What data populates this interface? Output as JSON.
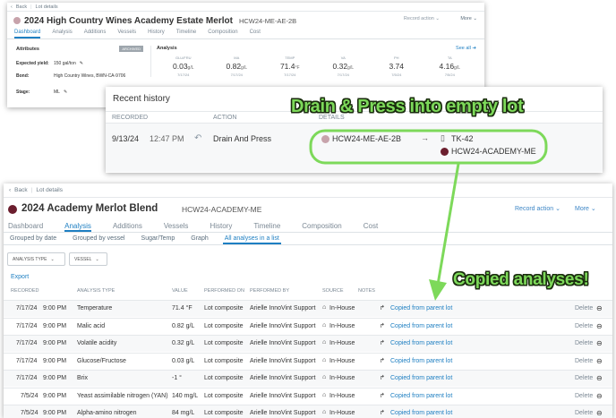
{
  "colors": {
    "accent": "#1e7fc2",
    "annotation": "#7dd95a",
    "dot_light": "#c7a3ab",
    "dot_dark": "#6b1e2e"
  },
  "panel1": {
    "back": "Back",
    "breadcrumb": "Lot details",
    "title": "2024 High Country Wines Academy Estate Merlot",
    "code": "HCW24-ME-AE-2B",
    "record_action": "Record action",
    "more": "More",
    "tabs": [
      "Dashboard",
      "Analysis",
      "Additions",
      "Vessels",
      "History",
      "Timeline",
      "Composition",
      "Cost"
    ],
    "attributes_header": "Attributes",
    "archived_badge": "ARCHIVED",
    "attributes": [
      {
        "label": "Expected yield:",
        "value": "150 gal/ton"
      },
      {
        "label": "Bond:",
        "value": "High Country Wines, BWN-CA-9706"
      },
      {
        "label": "Stage:",
        "value": "ML"
      }
    ],
    "analysis_header": "Analysis",
    "see_all": "See all",
    "analysis": [
      {
        "key": "GLU/FRU",
        "value": "0.03",
        "unit": "g/L",
        "date": "7/17/24"
      },
      {
        "key": "MA",
        "value": "0.82",
        "unit": "g/L",
        "date": "7/17/24"
      },
      {
        "key": "TEMP",
        "value": "71.4",
        "unit": "°F",
        "date": "7/17/24"
      },
      {
        "key": "VA",
        "value": "0.32",
        "unit": "g/L",
        "date": "7/17/24"
      },
      {
        "key": "PH",
        "value": "3.74",
        "unit": "",
        "date": "7/5/24"
      },
      {
        "key": "TA",
        "value": "4.16",
        "unit": "g/L",
        "date": "7/5/24"
      }
    ]
  },
  "panel2": {
    "title": "Recent history",
    "columns": [
      "RECORDED",
      "ACTION",
      "DETAILS"
    ],
    "row": {
      "date": "9/13/24",
      "time": "12:47 PM",
      "action": "Drain And Press",
      "source_lot": "HCW24-ME-AE-2B",
      "arrow": "→",
      "tank": "TK-42",
      "dest_lot": "HCW24-ACADEMY-ME"
    }
  },
  "panel3": {
    "back": "Back",
    "breadcrumb": "Lot details",
    "title": "2024 Academy Merlot Blend",
    "code": "HCW24-ACADEMY-ME",
    "record_action": "Record action",
    "more": "More",
    "tabs": [
      "Dashboard",
      "Analysis",
      "Additions",
      "Vessels",
      "History",
      "Timeline",
      "Composition",
      "Cost"
    ],
    "subtabs": [
      "Grouped by date",
      "Grouped by vessel",
      "Sugar/Temp",
      "Graph",
      "All analyses in a list"
    ],
    "filter_type": "ANALYSIS TYPE",
    "filter_vessel": "VESSEL",
    "export": "Export",
    "columns": [
      "RECORDED",
      "ANALYSIS TYPE",
      "VALUE",
      "PERFORMED ON",
      "PERFORMED BY",
      "SOURCE",
      "NOTES"
    ],
    "delete_label": "Delete",
    "rows": [
      {
        "date": "7/17/24",
        "time": "9:00 PM",
        "type": "Temperature",
        "value": "71.4 °F",
        "on": "Lot composite",
        "by": "Arielle InnoVint Support",
        "source": "In-House",
        "note": "Copied from parent lot"
      },
      {
        "date": "7/17/24",
        "time": "9:00 PM",
        "type": "Malic acid",
        "value": "0.82 g/L",
        "on": "Lot composite",
        "by": "Arielle InnoVint Support",
        "source": "In-House",
        "note": "Copied from parent lot"
      },
      {
        "date": "7/17/24",
        "time": "9:00 PM",
        "type": "Volatile acidity",
        "value": "0.32 g/L",
        "on": "Lot composite",
        "by": "Arielle InnoVint Support",
        "source": "In-House",
        "note": "Copied from parent lot"
      },
      {
        "date": "7/17/24",
        "time": "9:00 PM",
        "type": "Glucose/Fructose",
        "value": "0.03 g/L",
        "on": "Lot composite",
        "by": "Arielle InnoVint Support",
        "source": "In-House",
        "note": "Copied from parent lot"
      },
      {
        "date": "7/17/24",
        "time": "9:00 PM",
        "type": "Brix",
        "value": "-1 °",
        "on": "Lot composite",
        "by": "Arielle InnoVint Support",
        "source": "In-House",
        "note": "Copied from parent lot"
      },
      {
        "date": "7/5/24",
        "time": "9:00 PM",
        "type": "Yeast assimilable nitrogen (YAN)",
        "value": "140 mg/L",
        "on": "Lot composite",
        "by": "Arielle InnoVint Support",
        "source": "In-House",
        "note": "Copied from parent lot"
      },
      {
        "date": "7/5/24",
        "time": "9:00 PM",
        "type": "Alpha-amino nitrogen",
        "value": "84 mg/L",
        "on": "Lot composite",
        "by": "Arielle InnoVint Support",
        "source": "In-House",
        "note": "Copied from parent lot"
      }
    ]
  },
  "annotations": {
    "drain": "Drain & Press into empty lot",
    "copied": "Copied analyses!"
  }
}
